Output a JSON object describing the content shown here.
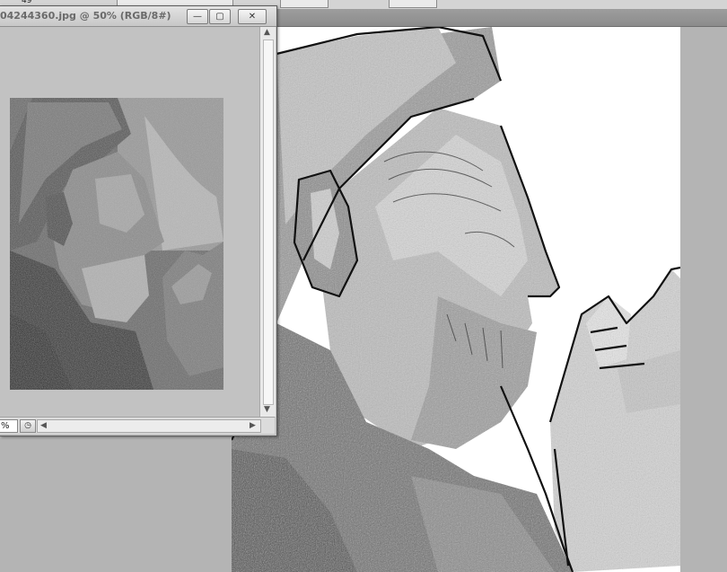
{
  "toolbar": {
    "value": "49"
  },
  "document_window": {
    "title": "04244360.jpg @ 50% (RGB/8#)",
    "zoom_field": "%",
    "buttons": {
      "minimize": "—",
      "restore": "▢",
      "close": "✕"
    },
    "nav_icon": "navigator-icon"
  },
  "colors": {
    "workspace": "#b4b4b4",
    "canvas": "#ffffff",
    "window": "#c6c6c6"
  }
}
